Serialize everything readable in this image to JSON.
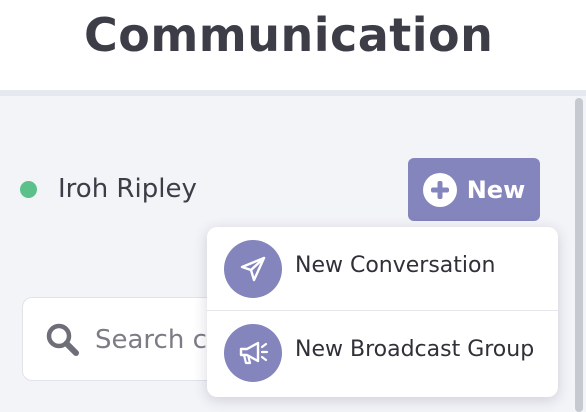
{
  "header": {
    "title": "Communication"
  },
  "user": {
    "name": "Iroh Ripley",
    "status": "online",
    "status_color": "#5cc08a"
  },
  "new_button": {
    "label": "New",
    "icon": "plus-circle-icon",
    "color": "#8585bd"
  },
  "dropdown": {
    "items": [
      {
        "label": "New Conversation",
        "icon": "send-icon"
      },
      {
        "label": "New Broadcast Group",
        "icon": "megaphone-icon"
      }
    ]
  },
  "search": {
    "placeholder": "Search c",
    "value": "",
    "icon": "search-icon"
  }
}
